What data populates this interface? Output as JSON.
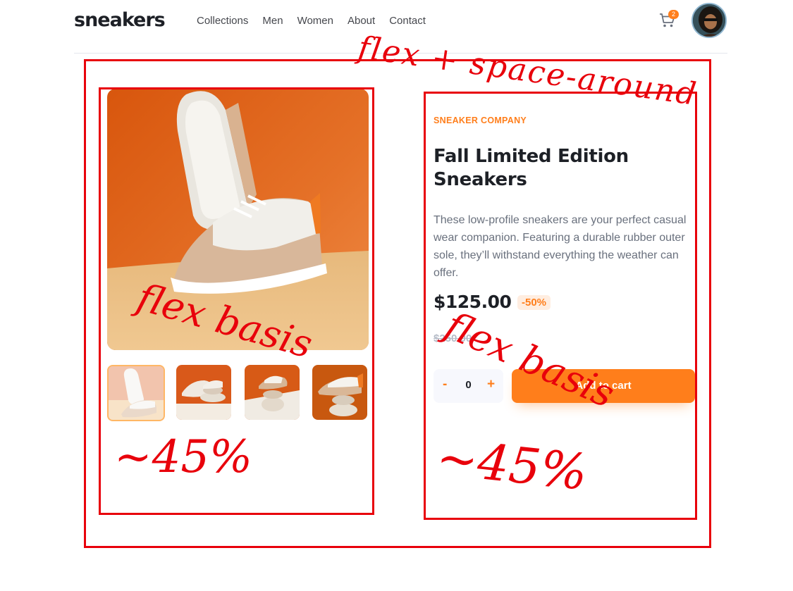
{
  "brand": {
    "logo": "sneakers"
  },
  "nav": {
    "items": [
      "Collections",
      "Men",
      "Women",
      "About",
      "Contact"
    ]
  },
  "cart": {
    "icon": "cart-icon",
    "count": "2"
  },
  "colors": {
    "accent": "#ff7e1b",
    "accent_light": "#ffede0",
    "annotation": "#e8000b",
    "text_dark": "#1d2026",
    "text_muted": "#69707d"
  },
  "product": {
    "company": "SNEAKER COMPANY",
    "title": "Fall Limited Edition Sneakers",
    "description": "These low-profile sneakers are your perfect casual wear companion. Featuring a durable rubber outer sole, they’ll withstand everything the weather can offer.",
    "price": "$125.00",
    "discount": "-50%",
    "old_price": "$250.00",
    "quantity": "0",
    "minus_label": "-",
    "plus_label": "+",
    "add_to_cart": "Add to cart"
  },
  "annotations": {
    "outer_note": "flex + space-around",
    "left_basis": "flex basis",
    "right_basis": "flex basis",
    "left_percent": "~45%",
    "right_percent": "~45%"
  }
}
